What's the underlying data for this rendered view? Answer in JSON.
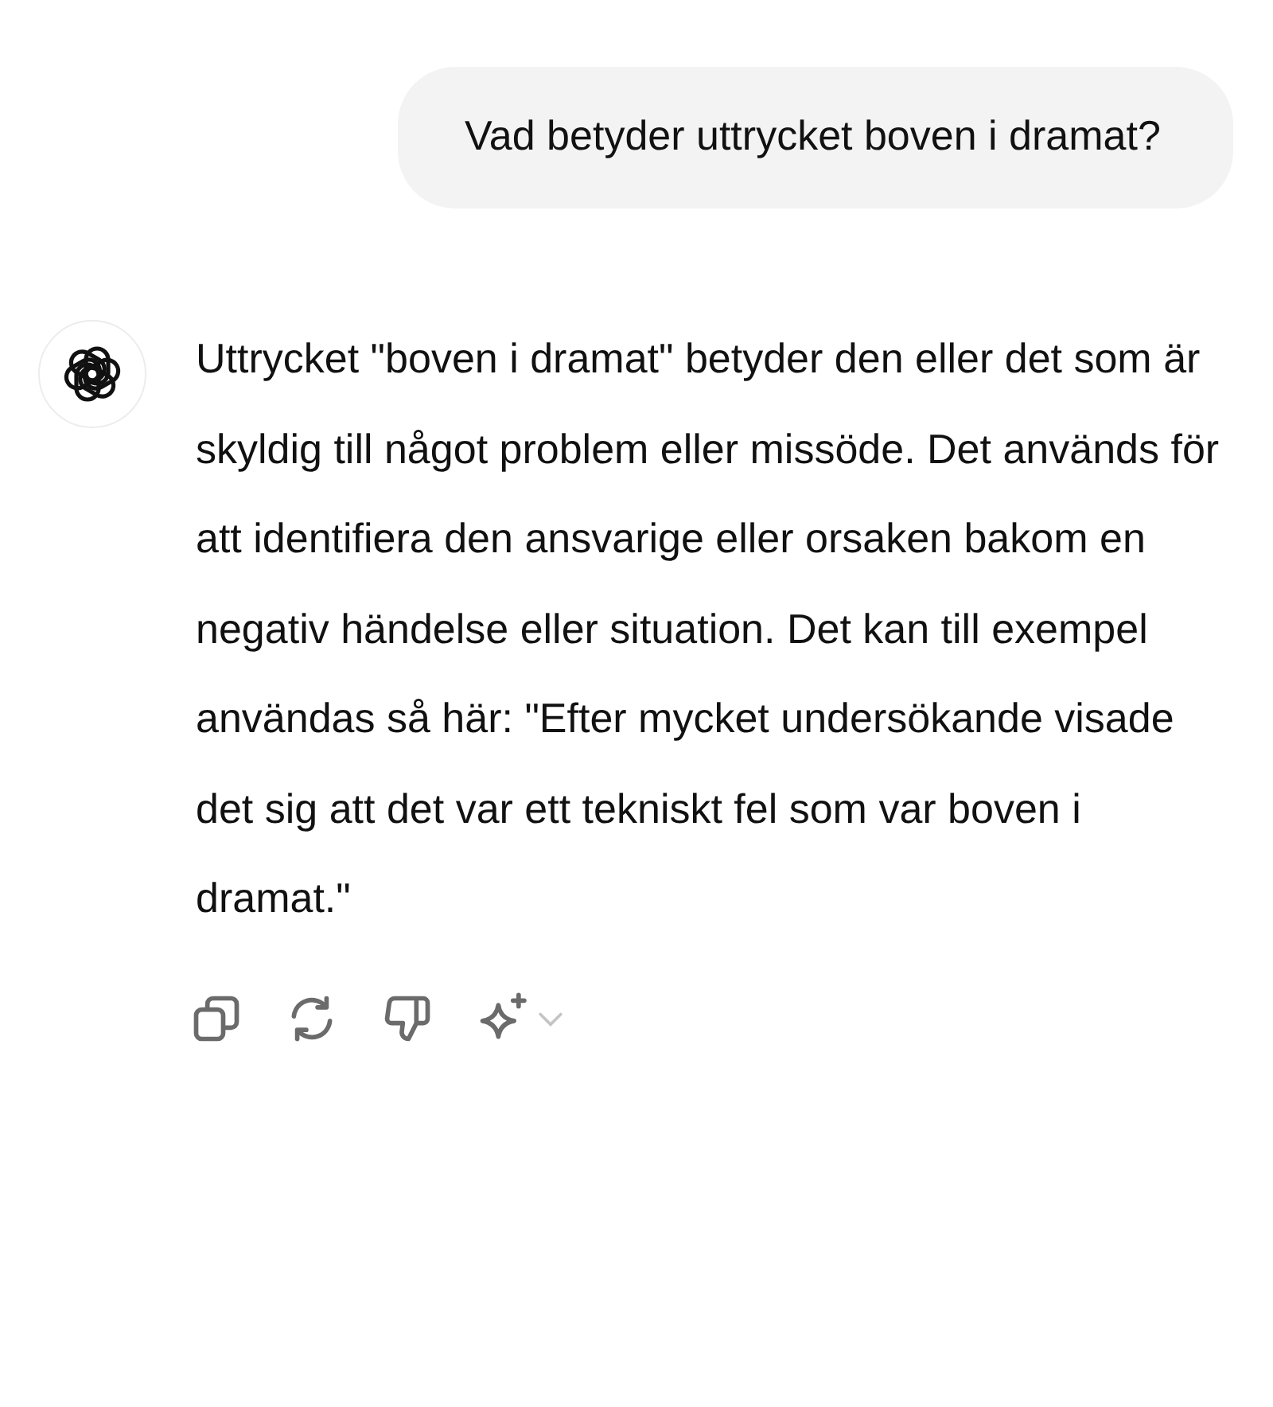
{
  "user_message": {
    "text": "Vad betyder uttrycket boven i dramat?"
  },
  "assistant_message": {
    "text": "Uttrycket \"boven i dramat\" betyder den eller det som är skyldig till något problem eller missöde. Det används för att identifiera den ansvarige eller orsaken bakom en negativ händelse eller situation. Det kan till exempel användas så här: \"Efter mycket undersökande visade det sig att det var ett tekniskt fel som var boven i dramat.\""
  },
  "actions": [
    {
      "kind": "copy"
    },
    {
      "kind": "regenerate"
    },
    {
      "kind": "dislike"
    },
    {
      "kind": "sparkle"
    }
  ]
}
